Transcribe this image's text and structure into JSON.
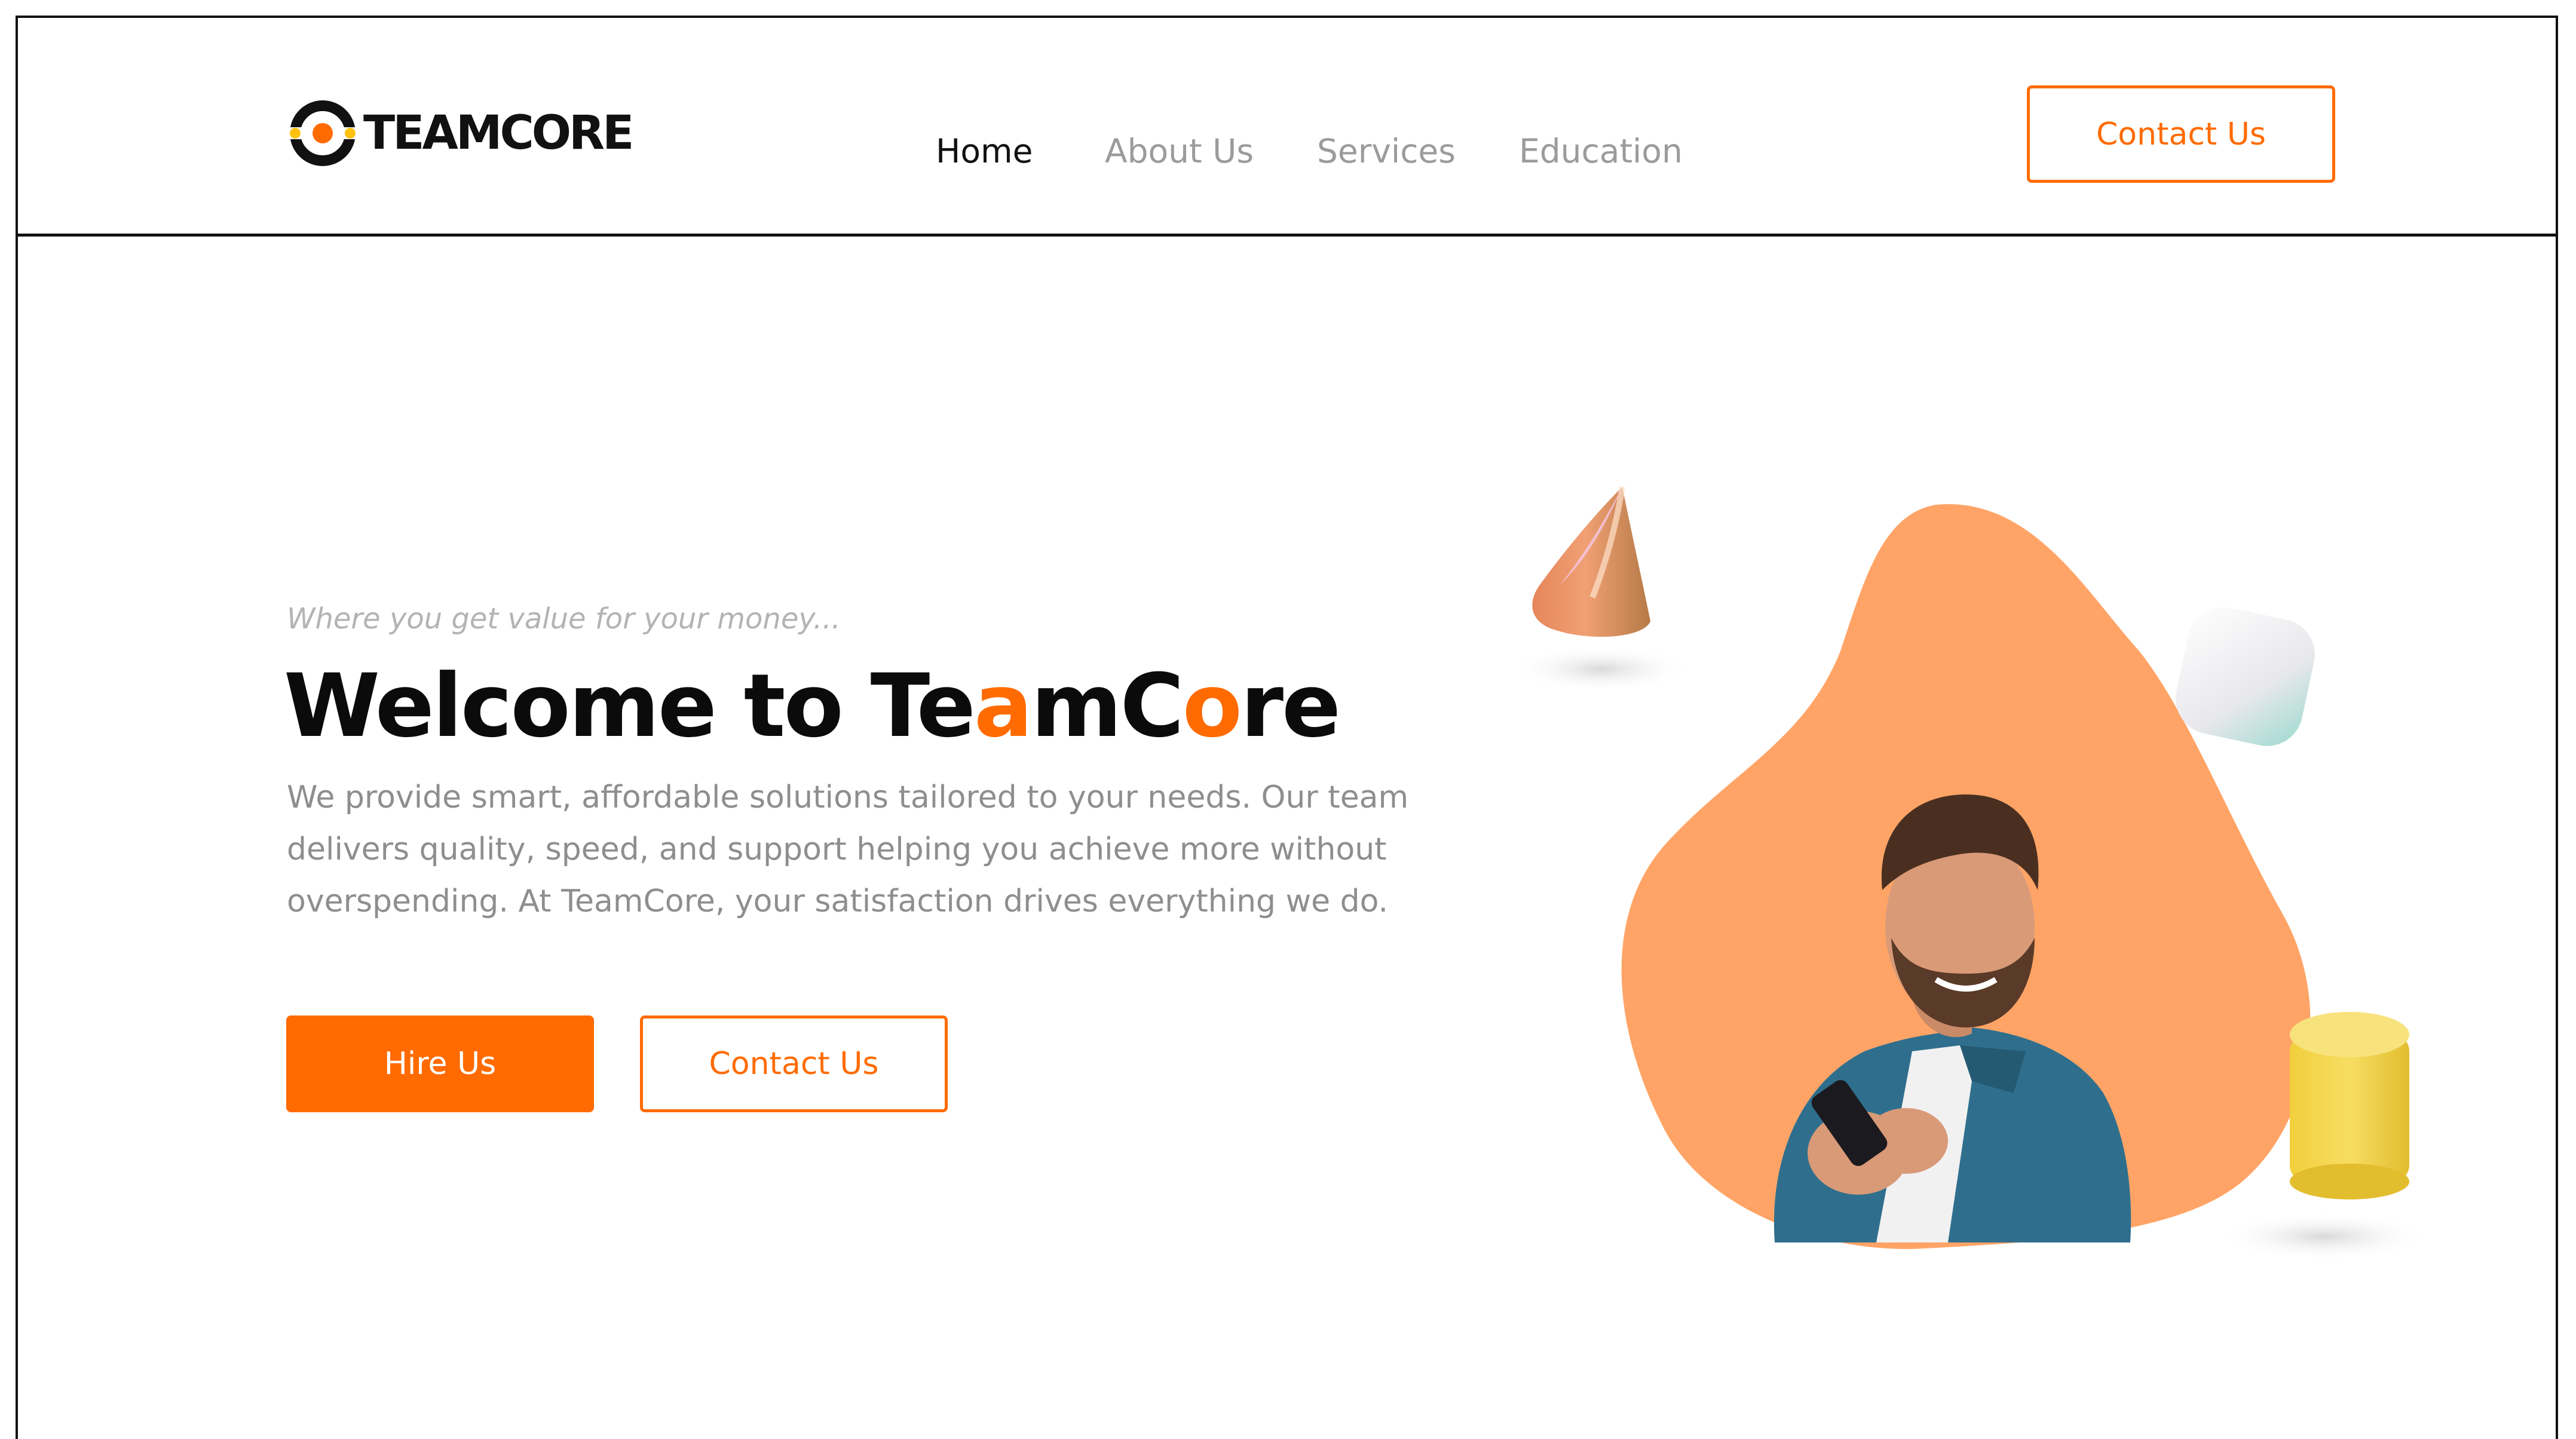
{
  "brand": {
    "logo_text": "TEAMCORE",
    "accent_color": "#ff6b00"
  },
  "nav": {
    "items": [
      "Home",
      "About Us",
      "Services",
      "Education"
    ],
    "active": "Home"
  },
  "header": {
    "contact_label": "Contact Us"
  },
  "hero": {
    "tagline": "Where you get value for your money...",
    "title_prefix": "Welcome to ",
    "title_parts": [
      "Te",
      "a",
      "mC",
      "o",
      "re"
    ],
    "description": "We provide smart, affordable solutions tailored to your needs. Our team delivers quality, speed, and support helping you achieve more without overspending. At TeamCore, your satisfaction drives everything we do.",
    "primary_button": "Hire Us",
    "secondary_button": "Contact Us"
  },
  "illustration": {
    "blob_color": "#ffa466",
    "shapes": [
      "cone-shape",
      "cube-shape",
      "cylinder-shape"
    ],
    "subject": "man-with-phone"
  }
}
